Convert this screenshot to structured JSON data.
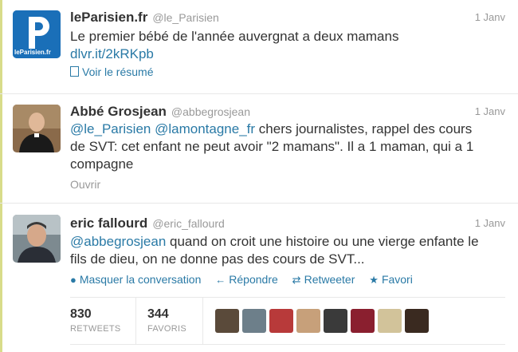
{
  "tweets": [
    {
      "name": "leParisien.fr",
      "handle": "@le_Parisien",
      "time": "1 Janv",
      "avatar_text": "P",
      "avatar_sub": "leParisien.fr",
      "text": "Le premier bébé de l'année auvergnat a deux mamans",
      "link": "dlvr.it/2kRKpb",
      "expand_label": "Voir le résumé"
    },
    {
      "name": "Abbé Grosjean",
      "handle": "@abbegrosjean",
      "time": "1 Janv",
      "mention1": "@le_Parisien",
      "mention2": "@lamontagne_fr",
      "text_line1": " chers journalistes, rappel des cours",
      "text_line2": "de SVT: cet enfant ne peut avoir \"2 mamans\". Il a 1 maman, qui a 1",
      "text_line3": "compagne",
      "expand_label": "Ouvrir"
    },
    {
      "name": "eric fallourd",
      "handle": "@eric_fallourd",
      "time": "1 Janv",
      "mention": "@abbegrosjean",
      "text_line1": " quand on croit une histoire ou une vierge enfante le",
      "text_line2": "fils de dieu, on ne donne pas des cours de SVT...",
      "actions": {
        "hide": "Masquer la conversation",
        "reply": "Répondre",
        "retweet": "Retweeter",
        "favorite": "Favori"
      },
      "stats": {
        "retweets_count": "830",
        "retweets_label": "RETWEETS",
        "favorites_count": "344",
        "favorites_label": "FAVORIS"
      }
    }
  ],
  "colors": {
    "link": "#2a7aa6",
    "muted": "#999999",
    "text": "#333333",
    "brand_blue": "#1a6fb8"
  },
  "favoriters": [
    "#5a4a3a",
    "#6d7f8a",
    "#b83a3a",
    "#c7a07a",
    "#3a3a3a",
    "#8a1f2f",
    "#d2c39a",
    "#3a2a20"
  ]
}
